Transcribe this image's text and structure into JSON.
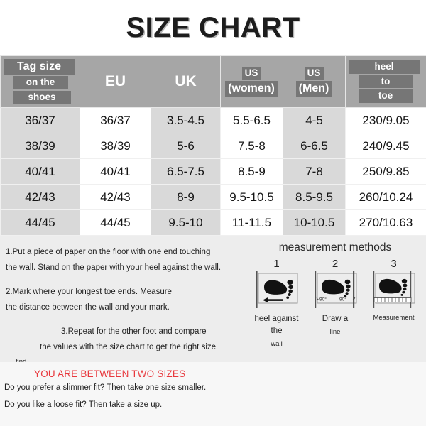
{
  "title": "SIZE CHART",
  "table": {
    "headers": [
      {
        "kind": "stack",
        "lines": [
          "Tag size",
          "on the",
          "shoes"
        ]
      },
      {
        "kind": "simple",
        "label": "EU"
      },
      {
        "kind": "simple",
        "label": "UK"
      },
      {
        "kind": "stack-center",
        "lines": [
          "US",
          "(women)"
        ]
      },
      {
        "kind": "stack-center",
        "lines": [
          "US",
          "(Men)"
        ]
      },
      {
        "kind": "stack",
        "lines": [
          "heel",
          "to",
          "toe"
        ]
      }
    ],
    "rows": [
      [
        "36/37",
        "36/37",
        "3.5-4.5",
        "5.5-6.5",
        "4-5",
        "230/9.05"
      ],
      [
        "38/39",
        "38/39",
        "5-6",
        "7.5-8",
        "6-6.5",
        "240/9.45"
      ],
      [
        "40/41",
        "40/41",
        "6.5-7.5",
        "8.5-9",
        "7-8",
        "250/9.85"
      ],
      [
        "42/43",
        "42/43",
        "8-9",
        "9.5-10.5",
        "8.5-9.5",
        "260/10.24"
      ],
      [
        "44/45",
        "44/45",
        "9.5-10",
        "11-11.5",
        "10-10.5",
        "270/10.63"
      ]
    ]
  },
  "steps": {
    "step1_line1": "1.Put a piece of paper on the floor with one end touching",
    "step1_line2": "the wall. Stand on the paper with your heel against the wall.",
    "step2_line1": "2.Mark where your longest toe ends. Measure",
    "step2_line2": "the distance between the wall and your mark.",
    "step3_line1": "3.Repeat for the other foot and compare",
    "step3_line2": "the values with the size chart to get the right size",
    "step3_line3": "find."
  },
  "methods": {
    "title": "measurement methods",
    "diagrams": [
      {
        "number": "1",
        "caption_line1": "heel against the",
        "caption_line2": "wall"
      },
      {
        "number": "2",
        "caption_line1": "Draw a",
        "caption_line2": "line",
        "angle_left": "90°",
        "angle_right": "90°"
      },
      {
        "number": "3",
        "caption_line1": "Measurement",
        "caption_line2": ""
      }
    ]
  },
  "footer": {
    "between_sizes": "YOU ARE BETWEEN TWO SIZES",
    "slimmer": "Do you prefer a slimmer fit? Then take one size smaller.",
    "loose": "Do you like a loose fit? Then take a size up."
  },
  "colors": {
    "header_bg": "#a6a6a6",
    "highlight_bg": "#767676",
    "row_shade": "#d9d9d9",
    "accent_red": "#e8383d",
    "page_bg": "#ededed"
  }
}
